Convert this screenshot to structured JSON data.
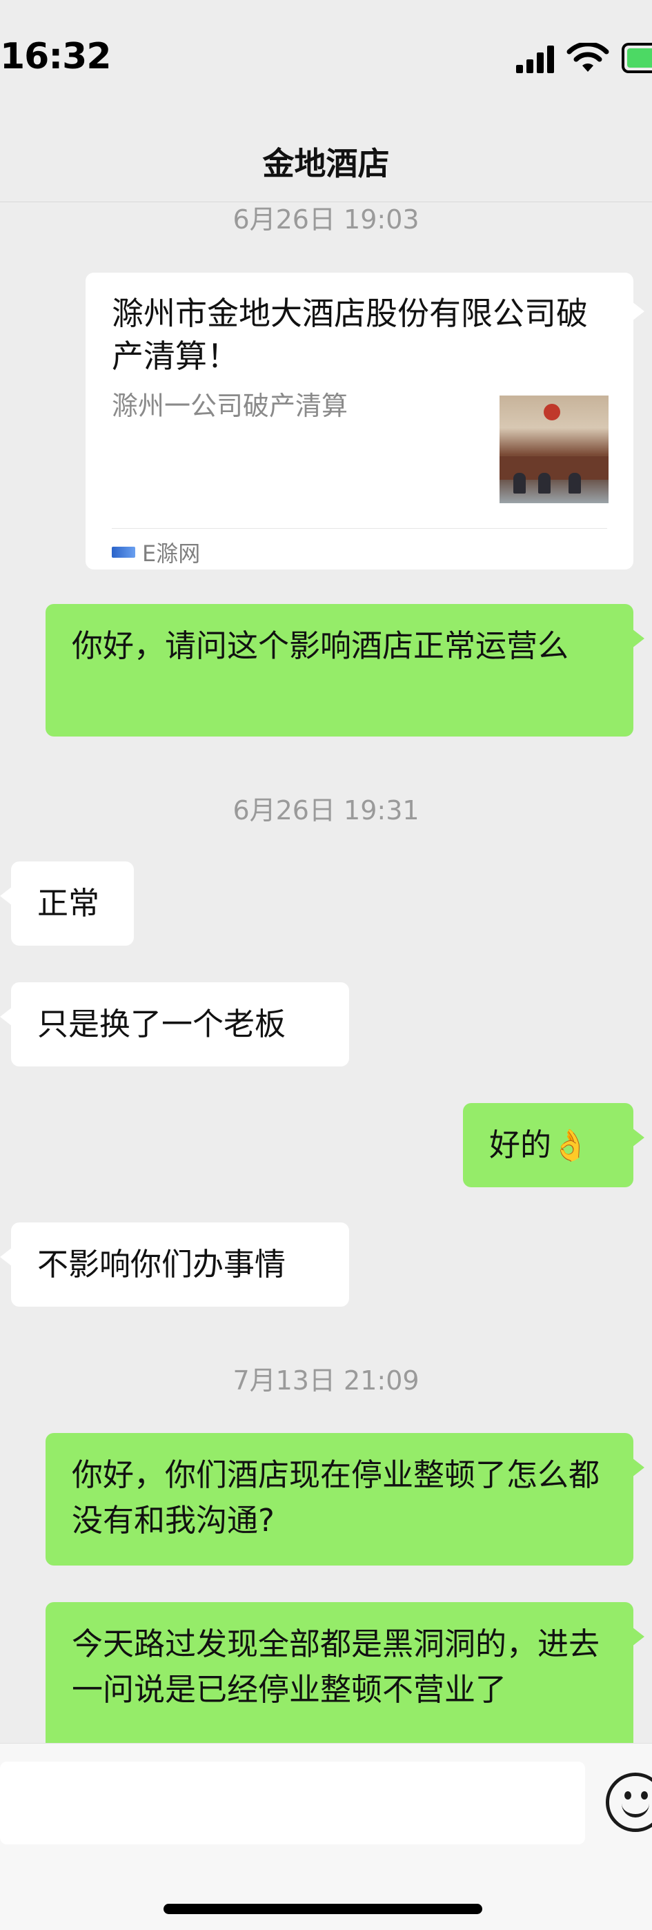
{
  "status": {
    "time": "16:32",
    "icons": [
      "signal-icon",
      "wifi-icon",
      "battery-icon"
    ],
    "battery_color": "#4cd964"
  },
  "header": {
    "title": "金地酒店"
  },
  "chat": {
    "ts1": "6月26日 19:03",
    "card": {
      "title": "滁州市金地大酒店股份有限公司破产清算！",
      "desc": "滁州一公司破产清算",
      "source": "E滁网"
    },
    "m1": "你好，请问这个影响酒店正常运营么",
    "ts2": "6月26日 19:31",
    "m2": "正常",
    "m3": "只是换了一个老板",
    "m4": "好的",
    "m4_emoji": "👌",
    "m5": "不影响你们办事情",
    "ts3": "7月13日 21:09",
    "m6": "你好，你们酒店现在停业整顿了怎么都没有和我沟通?",
    "m7": "今天路过发现全部都是黑洞洞的，进去一问说是已经停业整顿不营业了"
  },
  "colors": {
    "bubble_out": "#95ec69",
    "bubble_in": "#ffffff",
    "background": "#ededed"
  }
}
